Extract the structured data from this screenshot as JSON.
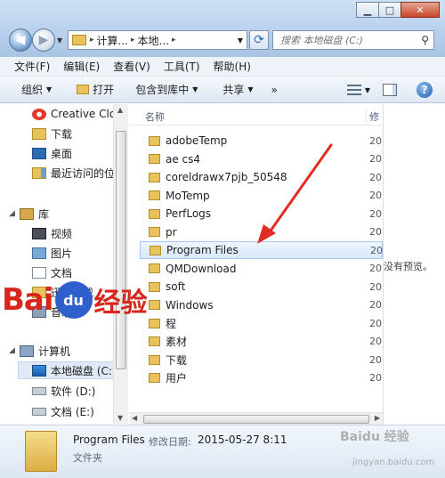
{
  "window": {
    "buttons": {
      "minimize": "▁",
      "maximize": "□",
      "close": "✕"
    }
  },
  "address": {
    "segments": [
      "计算...",
      "本地..."
    ],
    "separator": "▸"
  },
  "search": {
    "placeholder": "搜索 本地磁盘 (C:)"
  },
  "menu": {
    "items": [
      "文件(F)",
      "编辑(E)",
      "查看(V)",
      "工具(T)",
      "帮助(H)"
    ]
  },
  "toolbar": {
    "organize": "组织",
    "open": "打开",
    "include_in_library": "包含到库中",
    "share": "共享",
    "more": "»",
    "help_glyph": "?"
  },
  "nav": {
    "items": [
      {
        "label": "Creative Clo",
        "icon": "creative-cloud-icon"
      },
      {
        "label": "下载",
        "icon": "folder-icon"
      },
      {
        "label": "桌面",
        "icon": "desktop-icon"
      },
      {
        "label": "最近访问的位",
        "icon": "recent-places-icon"
      },
      {
        "label": "库",
        "icon": "library-icon"
      },
      {
        "label": "视频",
        "icon": "video-icon"
      },
      {
        "label": "图片",
        "icon": "picture-icon"
      },
      {
        "label": "文档",
        "icon": "document-icon"
      },
      {
        "label": "迅雷下载",
        "icon": "folder-icon"
      },
      {
        "label": "音乐",
        "icon": "music-icon"
      },
      {
        "label": "计算机",
        "icon": "computer-icon"
      },
      {
        "label": "本地磁盘 (C:)",
        "icon": "local-disk-icon"
      },
      {
        "label": "软件 (D:)",
        "icon": "drive-icon"
      },
      {
        "label": "文档 (E:)",
        "icon": "drive-icon"
      }
    ]
  },
  "filelist": {
    "columns": {
      "name": "名称",
      "modified": "修"
    },
    "rows": [
      {
        "name": "adobeTemp",
        "date": "20"
      },
      {
        "name": "ae cs4",
        "date": "20"
      },
      {
        "name": "coreldrawx7pjb_50548",
        "date": "20"
      },
      {
        "name": "MoTemp",
        "date": "20"
      },
      {
        "name": "PerfLogs",
        "date": "20"
      },
      {
        "name": "pr",
        "date": "20"
      },
      {
        "name": "Program Files",
        "date": "20",
        "selected": true
      },
      {
        "name": "QMDownload",
        "date": "20"
      },
      {
        "name": "soft",
        "date": "20"
      },
      {
        "name": "Windows",
        "date": "20"
      },
      {
        "name": "程",
        "date": "20"
      },
      {
        "name": "素材",
        "date": "20"
      },
      {
        "name": "下载",
        "date": "20"
      },
      {
        "name": "用户",
        "date": "20"
      }
    ]
  },
  "preview": {
    "empty_text": "没有预览。"
  },
  "details": {
    "name": "Program Files",
    "modified_label": "修改日期:",
    "modified_value": "2015-05-27 8:11",
    "type": "文件夹"
  },
  "watermark": {
    "bai": "Bai",
    "du": "du",
    "jingyan": "经验",
    "bottom_text": "Baidu 经验",
    "bottom_url": "jingyan.baidu.com"
  },
  "colors": {
    "arrow": "#e32d22",
    "selection": "#d9e8fa",
    "chrome": "#b9d1ec"
  }
}
